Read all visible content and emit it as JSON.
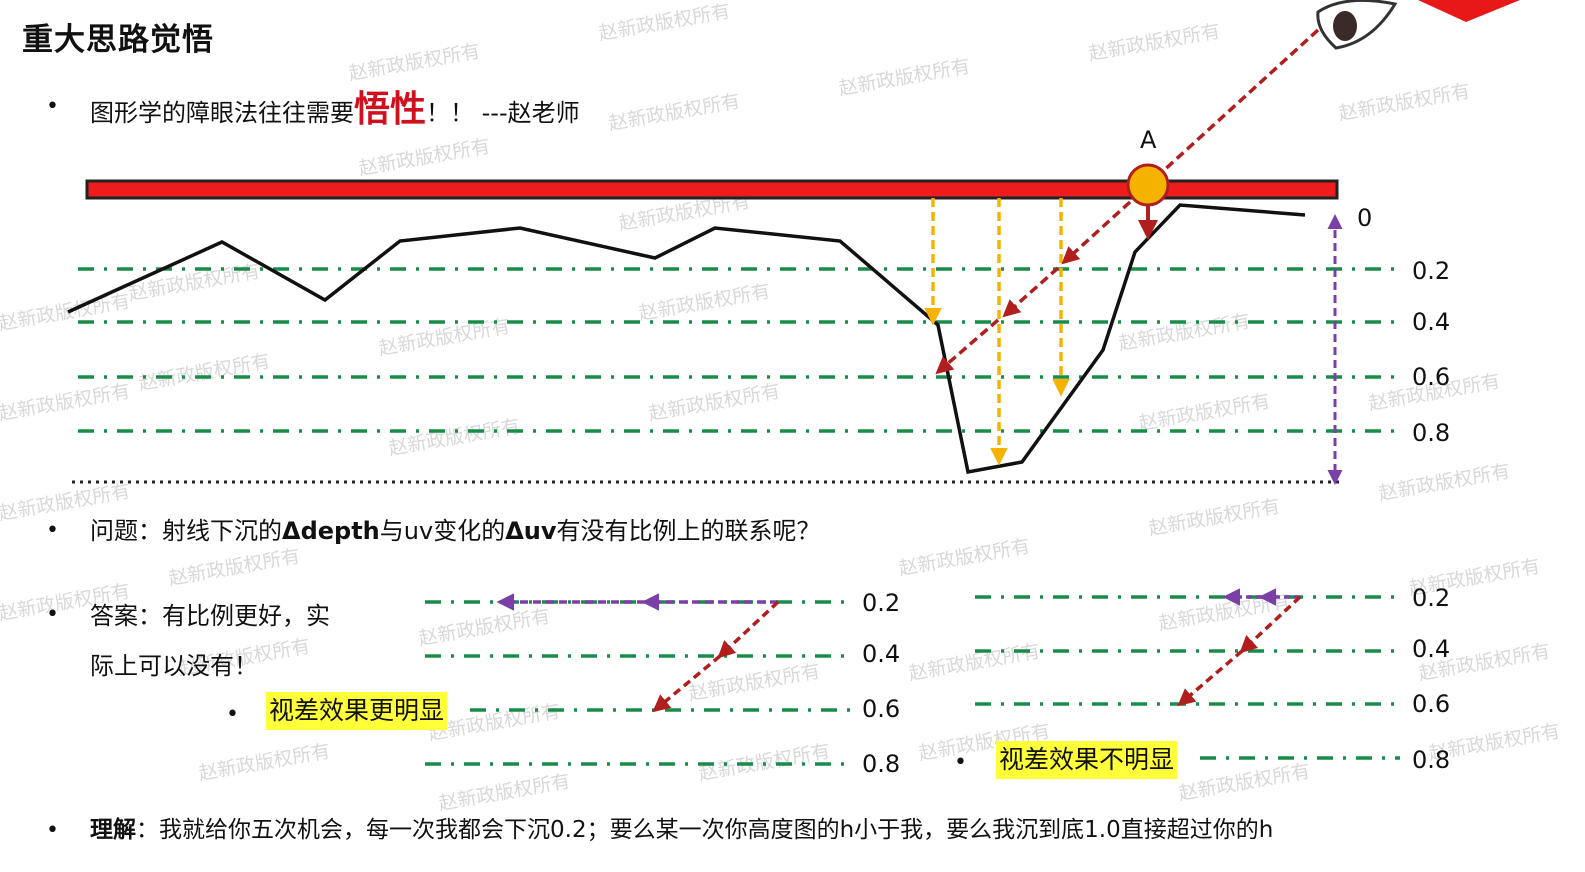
{
  "title": "重大思路觉悟",
  "bullet1": {
    "prefix": "图形学的障眼法往往需要",
    "emphasis": "悟性",
    "suffix": "！！ ---赵老师"
  },
  "diagram": {
    "point_label": "A",
    "levels": [
      "0",
      "0.2",
      "0.4",
      "0.6",
      "0.8"
    ]
  },
  "question": {
    "prefix": "问题：射线下沉的",
    "term1": "Δdepth",
    "middle": "与uv变化的",
    "term2": "Δuv",
    "suffix": "有没有比例上的联系呢？"
  },
  "answer": {
    "line1": "答案：有比例更好，实",
    "line2": "际上可以没有！"
  },
  "left_panel": {
    "levels": [
      "0.2",
      "0.4",
      "0.6",
      "0.8"
    ],
    "note": "视差效果更明显"
  },
  "right_panel": {
    "levels": [
      "0.2",
      "0.4",
      "0.6",
      "0.8"
    ],
    "note": "视差效果不明显"
  },
  "understanding": {
    "label": "理解",
    "text": "：我就给你五次机会，每一次我都会下沉0.2；要么某一次你高度图的h小于我，要么我沉到底1.0直接超过你的h"
  },
  "watermark": "赵新政版权所有",
  "colors": {
    "surface_bar": "#ee1c1c",
    "green_dash": "#1a8c4a",
    "ray": "#b01e1e",
    "orange_arrow": "#f5b300",
    "purple": "#7b3fa8",
    "highlight": "#ffff3a"
  }
}
